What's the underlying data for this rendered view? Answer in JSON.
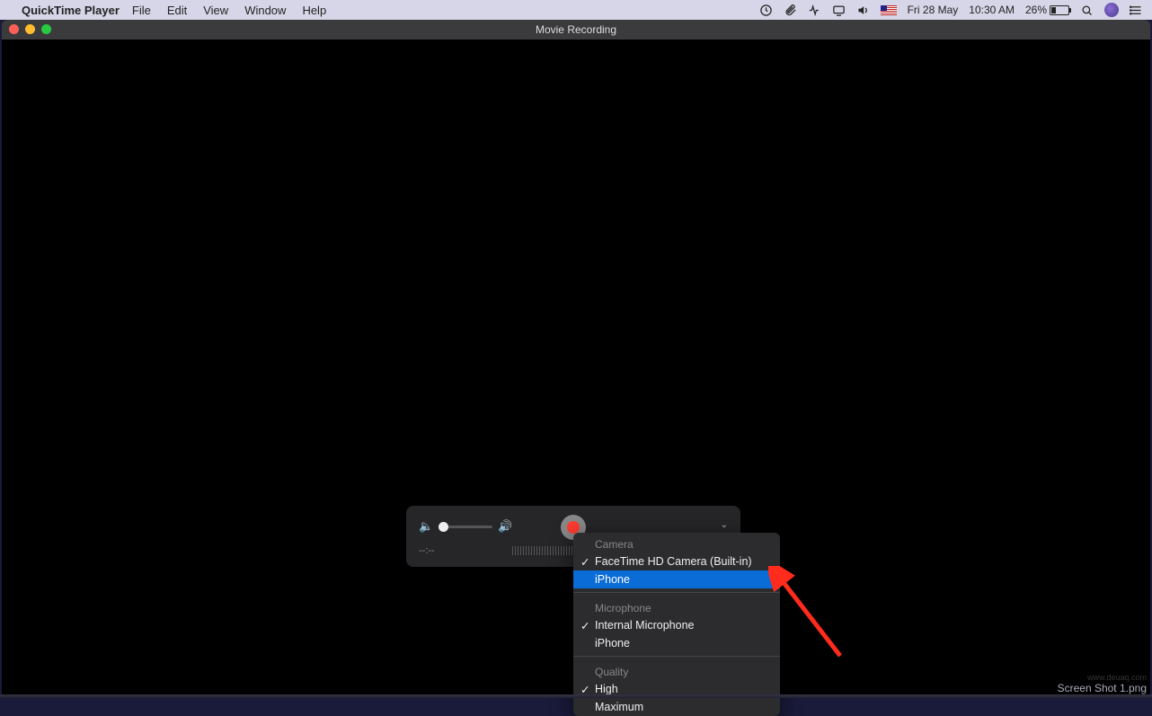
{
  "menubar": {
    "app_name": "QuickTime Player",
    "items": [
      "File",
      "Edit",
      "View",
      "Window",
      "Help"
    ],
    "status": {
      "date": "Fri 28 May",
      "time": "10:30 AM",
      "battery_percent": "26%"
    }
  },
  "window": {
    "title": "Movie Recording"
  },
  "controls": {
    "time_display": "--:--"
  },
  "dropdown": {
    "sections": [
      {
        "label": "Camera",
        "items": [
          {
            "label": "FaceTime HD Camera (Built-in)",
            "checked": true,
            "highlight": false
          },
          {
            "label": "iPhone",
            "checked": false,
            "highlight": true
          }
        ]
      },
      {
        "label": "Microphone",
        "items": [
          {
            "label": "Internal Microphone",
            "checked": true,
            "highlight": false
          },
          {
            "label": "iPhone",
            "checked": false,
            "highlight": false
          }
        ]
      },
      {
        "label": "Quality",
        "items": [
          {
            "label": "High",
            "checked": true,
            "highlight": false
          },
          {
            "label": "Maximum",
            "checked": false,
            "highlight": false
          }
        ]
      }
    ]
  },
  "footer": {
    "filename": "Screen Shot 1.png",
    "watermark": "www.deuaq.com"
  }
}
